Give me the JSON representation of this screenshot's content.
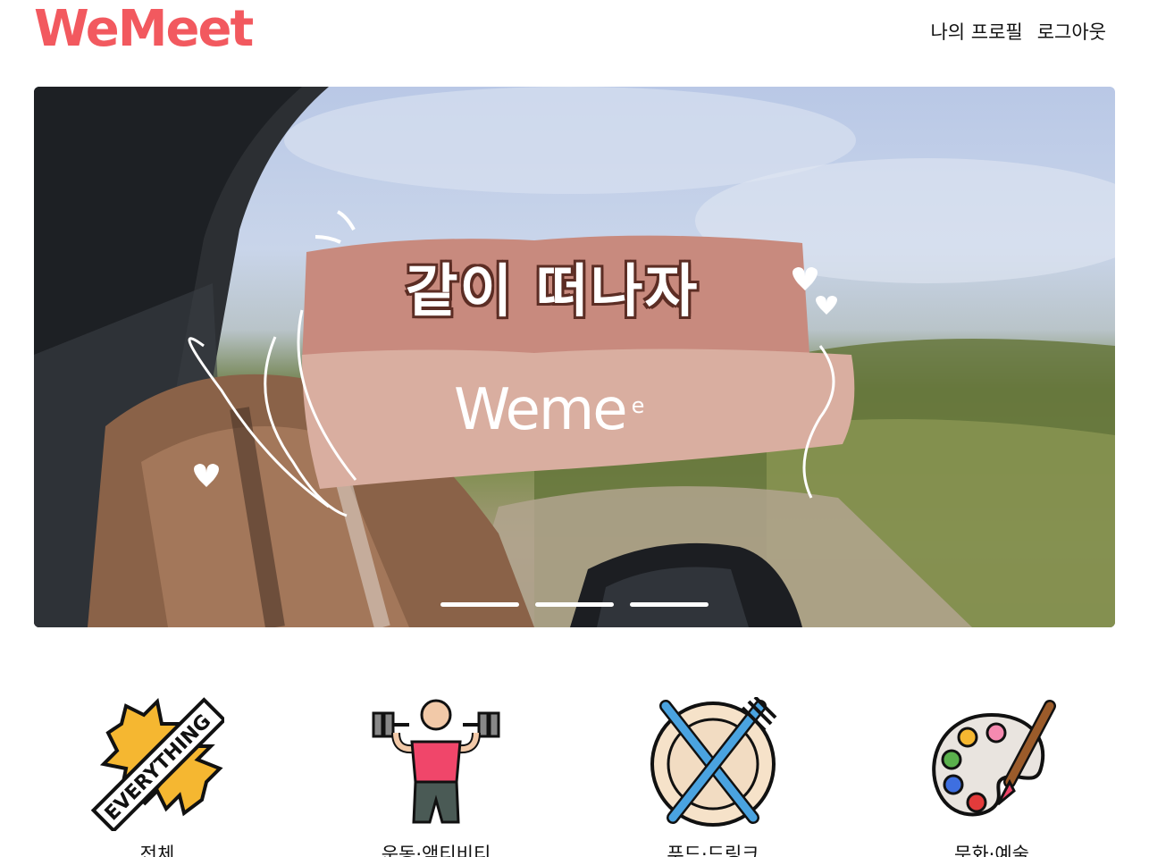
{
  "header": {
    "logo": "WeMeet",
    "nav": [
      "나의 프로필",
      "로그아웃"
    ]
  },
  "banner": {
    "title": "같이 떠나자",
    "subtitle": "Weme",
    "subtitle_small": "e",
    "slides": 3,
    "active_slide": 1
  },
  "categories": [
    {
      "label": "전체",
      "icon": "everything-badge-icon"
    },
    {
      "label": "운동·액티비티",
      "icon": "dumbbell-workout-icon"
    },
    {
      "label": "푸드·드링크",
      "icon": "fork-knife-plate-icon"
    },
    {
      "label": "문화·예술",
      "icon": "paint-palette-icon"
    }
  ],
  "colors": {
    "brand": "#f2595f",
    "banner_top": "#c88a7e",
    "banner_bottom": "#d9aea0"
  }
}
